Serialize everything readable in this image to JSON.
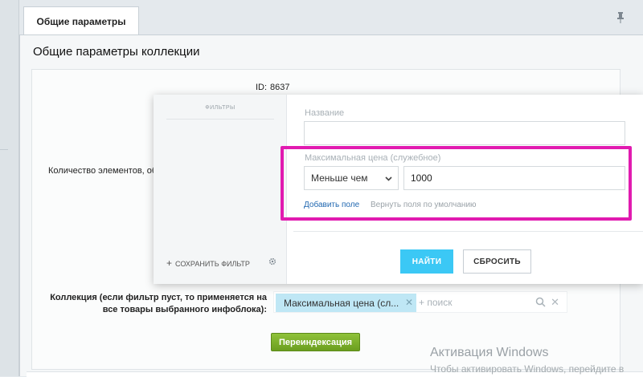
{
  "tab": {
    "label": "Общие параметры"
  },
  "section": {
    "title": "Общие параметры коллекции"
  },
  "fields": {
    "id_label": "ID:",
    "id_value": "8637",
    "count_label": "Количество элементов, обра",
    "collection_label": "Коллекция (если фильтр пуст, то применяется на все товары выбранного инфоблока):"
  },
  "filter_popup": {
    "filters_title": "ФИЛЬТРЫ",
    "save_filter_label": "СОХРАНИТЬ ФИЛЬТР",
    "name_label": "Название",
    "name_value": "",
    "price_label": "Максимальная цена (служебное)",
    "condition_value": "Меньше чем",
    "price_value": "1000",
    "add_field_link": "Добавить поле",
    "reset_fields_link": "Вернуть поля по умолчанию",
    "find_button": "НАЙТИ",
    "reset_button": "СБРОСИТЬ",
    "highlight_color": "#e11bb0"
  },
  "collection_filter": {
    "chip_text": "Максимальная цена (сл...",
    "search_placeholder": "+ поиск"
  },
  "reindex_button": "Переиндексация",
  "watermark": {
    "title": "Активация Windows",
    "subtitle": "Чтобы активировать Windows, перейдите в"
  },
  "colors": {
    "accent_blue": "#3bc8f5",
    "chip_bg": "#bfe7f5",
    "green_button": "#7cb12b"
  },
  "icons": [
    "pin-icon",
    "gear-icon",
    "chevron-down-icon",
    "search-icon",
    "close-icon"
  ]
}
